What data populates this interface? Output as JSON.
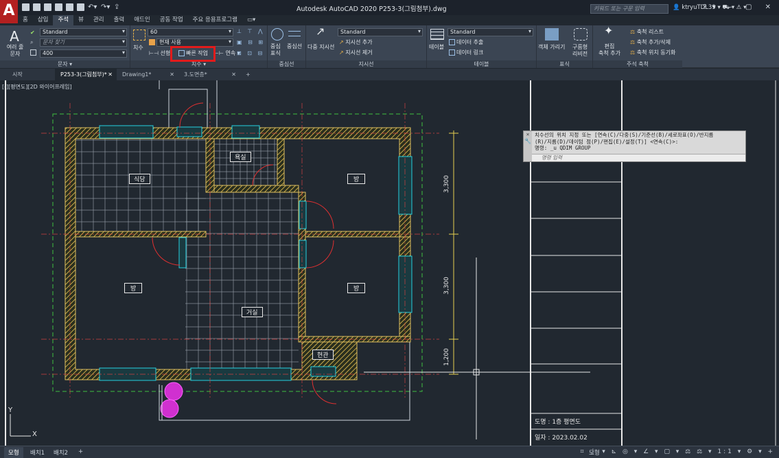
{
  "app": {
    "window_title": "Autodesk AutoCAD 2020    P253-3(그림첨부).dwg",
    "search_placeholder": "키워드 또는 구문 입력",
    "user": "ktryuTDL39"
  },
  "menu_tabs": [
    "홈",
    "삽입",
    "주석",
    "뷰",
    "관리",
    "출력",
    "애드인",
    "공동 작업",
    "주요 응용프로그램"
  ],
  "active_menu_tab": "주석",
  "ribbon": {
    "text_panel": {
      "big_button": "여러 줄\n문자",
      "style_combo": "Standard",
      "find_placeholder": "문자 찾기",
      "height_combo": "400",
      "label": "문자 ▾"
    },
    "dim_panel": {
      "big_button": "치수",
      "scale_combo": "60",
      "layer_combo": "현재 사용",
      "linear_label": "선형",
      "quick_label": "빠른 작업",
      "continue_label": "연속",
      "label": "치수 ▾"
    },
    "center_panel": {
      "center_mark": "중심\n표식",
      "center_line": "중심선",
      "label": "중심선"
    },
    "leader_panel": {
      "multileader": "다중 지시선",
      "style_combo": "Standard",
      "add": "지시선 추가",
      "remove": "지시선 제거",
      "label": "지시선"
    },
    "table_panel": {
      "table": "테이블",
      "style_combo": "Standard",
      "extract": "데이터 추출",
      "link": "데이터 링크",
      "label": "테이블"
    },
    "markup_panel": {
      "wipeout": "객체 가리기",
      "revcloud": "구름형\n리비전",
      "label": "표식"
    },
    "scale_panel": {
      "add_scale": "편집\n축척 추가",
      "list": "축척 리스트",
      "add_delete": "축척 추가/삭제",
      "sync": "축척 위치 동기화",
      "label": "주석 축척"
    }
  },
  "file_tabs": [
    {
      "label": "시작",
      "closable": false
    },
    {
      "label": "P253-3(그림첨부)*",
      "closable": true
    },
    {
      "label": "Drawing1*",
      "closable": true
    },
    {
      "label": "3.도면층*",
      "closable": true
    }
  ],
  "viewport_label": "[-][평면도][2D 와이어프레임]",
  "rooms": [
    "식당",
    "욕실",
    "방",
    "방",
    "거실",
    "방",
    "현관"
  ],
  "dims": [
    "3,300",
    "3,300",
    "1,200"
  ],
  "command": {
    "line1": "치수선의 위치 지정 또는 [연속(C)/다중(S)/기준선(B)/세로좌표(O)/반지름",
    "line2": "(R)/지름(D)/데이텀 점(P)/편집(E)/설정(T)] <연속(C)>:",
    "line3": "명령: _u QDIM GROUP",
    "input_placeholder": "명령 입력"
  },
  "title_block": {
    "drawing_name": "도명 : 1층 평면도",
    "date": "일자 : 2023.02.02"
  },
  "layout_tabs": [
    "모형",
    "배치1",
    "배치2"
  ],
  "status_model": "모형",
  "status_scale": "1:1"
}
